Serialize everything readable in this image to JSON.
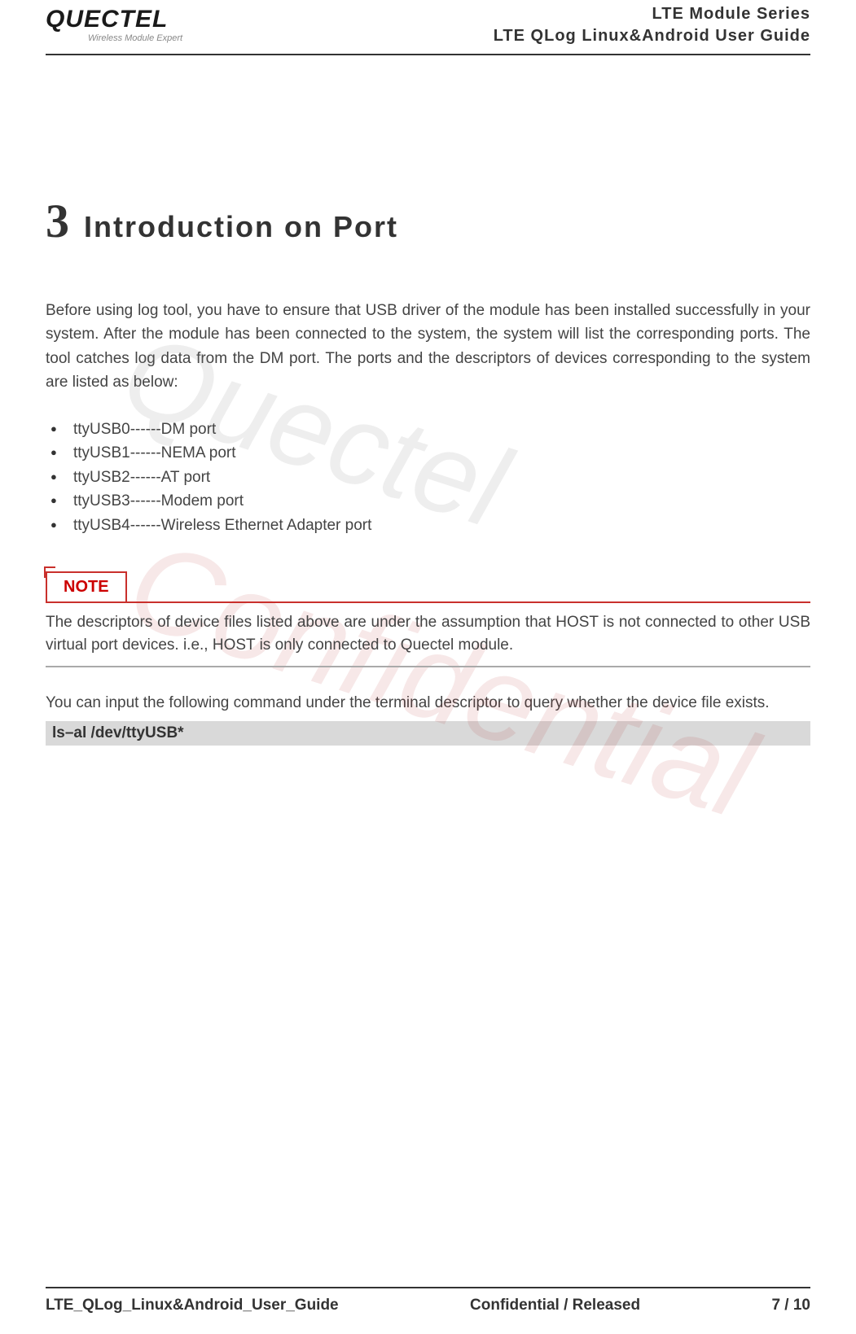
{
  "header": {
    "logo_text": "QUECTEL",
    "logo_tagline": "Wireless Module Expert",
    "line1": "LTE  Module  Series",
    "line2": "LTE  QLog  Linux&Android  User  Guide"
  },
  "chapter": {
    "number": "3",
    "title": "Introduction  on  Port"
  },
  "intro_paragraph": "Before using log tool, you have to ensure that USB driver of the module has been installed successfully in your system. After the module has been connected to the system, the system will list the corresponding ports. The tool catches log data from the DM port. The ports and the descriptors of devices corresponding to the system are listed as below:",
  "ports": [
    "ttyUSB0------DM port",
    "ttyUSB1------NEMA port",
    "ttyUSB2------AT port",
    "ttyUSB3------Modem port",
    "ttyUSB4------Wireless Ethernet Adapter port"
  ],
  "note": {
    "label": "NOTE",
    "body": "The descriptors of device files listed above are under the assumption that HOST is not connected to other USB virtual port devices. i.e., HOST is only connected to Quectel module."
  },
  "query_text": "You can input the following command under the terminal descriptor to query whether the device file exists.",
  "command": "ls–al /dev/ttyUSB*",
  "watermarks": {
    "wm1": "Quectel",
    "wm2": "Confidential"
  },
  "footer": {
    "left": "LTE_QLog_Linux&Android_User_Guide",
    "center": "Confidential / Released",
    "right": "7 / 10"
  }
}
